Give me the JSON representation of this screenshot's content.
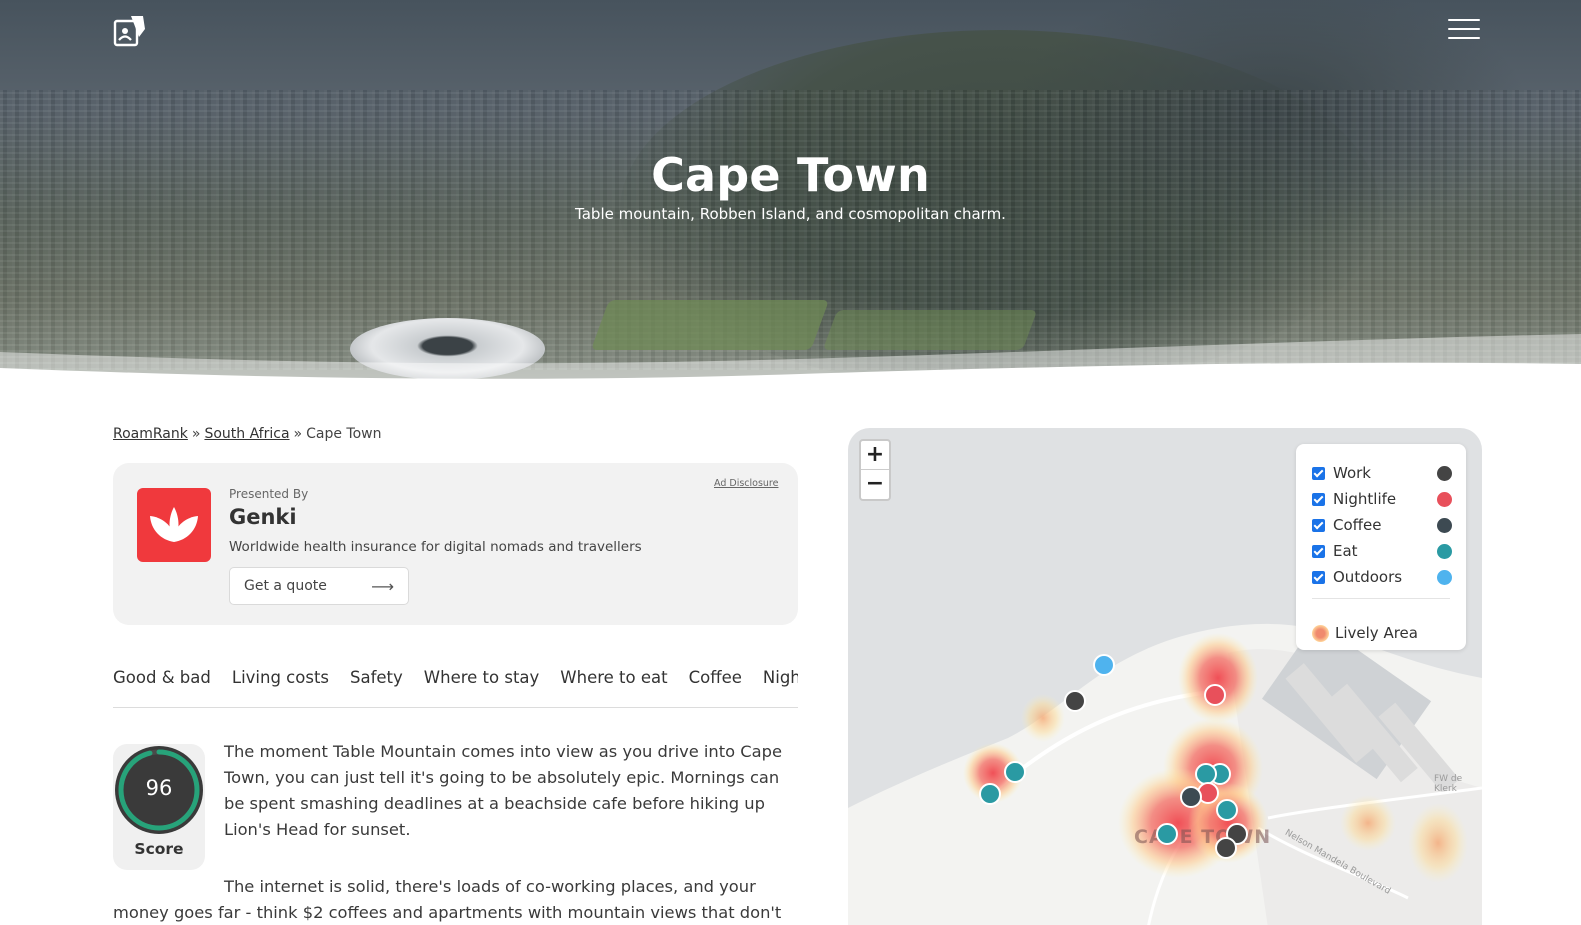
{
  "hero": {
    "title": "Cape Town",
    "subtitle": "Table mountain, Robben Island, and cosmopolitan charm."
  },
  "icons": {
    "logo": "roamrank-logo-icon",
    "menu": "hamburger-menu-icon",
    "ad_logo": "genki-leaf-icon",
    "cta_arrow": "arrow-right-icon"
  },
  "breadcrumb": {
    "items": [
      "RoamRank",
      "South Africa",
      "Cape Town"
    ],
    "separator": "»"
  },
  "ad": {
    "label": "Presented By",
    "name": "Genki",
    "description": "Worldwide health insurance for digital nomads and travellers",
    "cta": "Get a quote",
    "disclosure": "Ad Disclosure",
    "brand_color": "#f0393d"
  },
  "tabs": [
    "Good & bad",
    "Living costs",
    "Safety",
    "Where to stay",
    "Where to eat",
    "Coffee",
    "Nightlife"
  ],
  "score": {
    "value": "96",
    "label": "Score",
    "fraction": 0.96,
    "ring_color": "#27a37a"
  },
  "content": {
    "para1": "The moment Table Mountain comes into view as you drive into Cape Town, you can just tell it's going to be absolutely epic. Mornings can be spent smashing deadlines at a beachside cafe before hiking up Lion's Head for sunset.",
    "para2": "The internet is solid, there's loads of co-working places, and your money goes far - think $2 coffees and apartments with mountain views that don't"
  },
  "map": {
    "zoom_in": "+",
    "zoom_out": "−",
    "city_label": "CAPE TOWN",
    "road_labels": [
      "FW de Klerk",
      "Nelson Mandela Boulevard"
    ],
    "legend": [
      {
        "label": "Work",
        "color": "#444444",
        "checked": true
      },
      {
        "label": "Nightlife",
        "color": "#e8505b",
        "checked": true
      },
      {
        "label": "Coffee",
        "color": "#3d4a52",
        "checked": true
      },
      {
        "label": "Eat",
        "color": "#2a9aa3",
        "checked": true
      },
      {
        "label": "Outdoors",
        "color": "#4fb3ee",
        "checked": true
      }
    ],
    "lively_label": "Lively Area"
  }
}
